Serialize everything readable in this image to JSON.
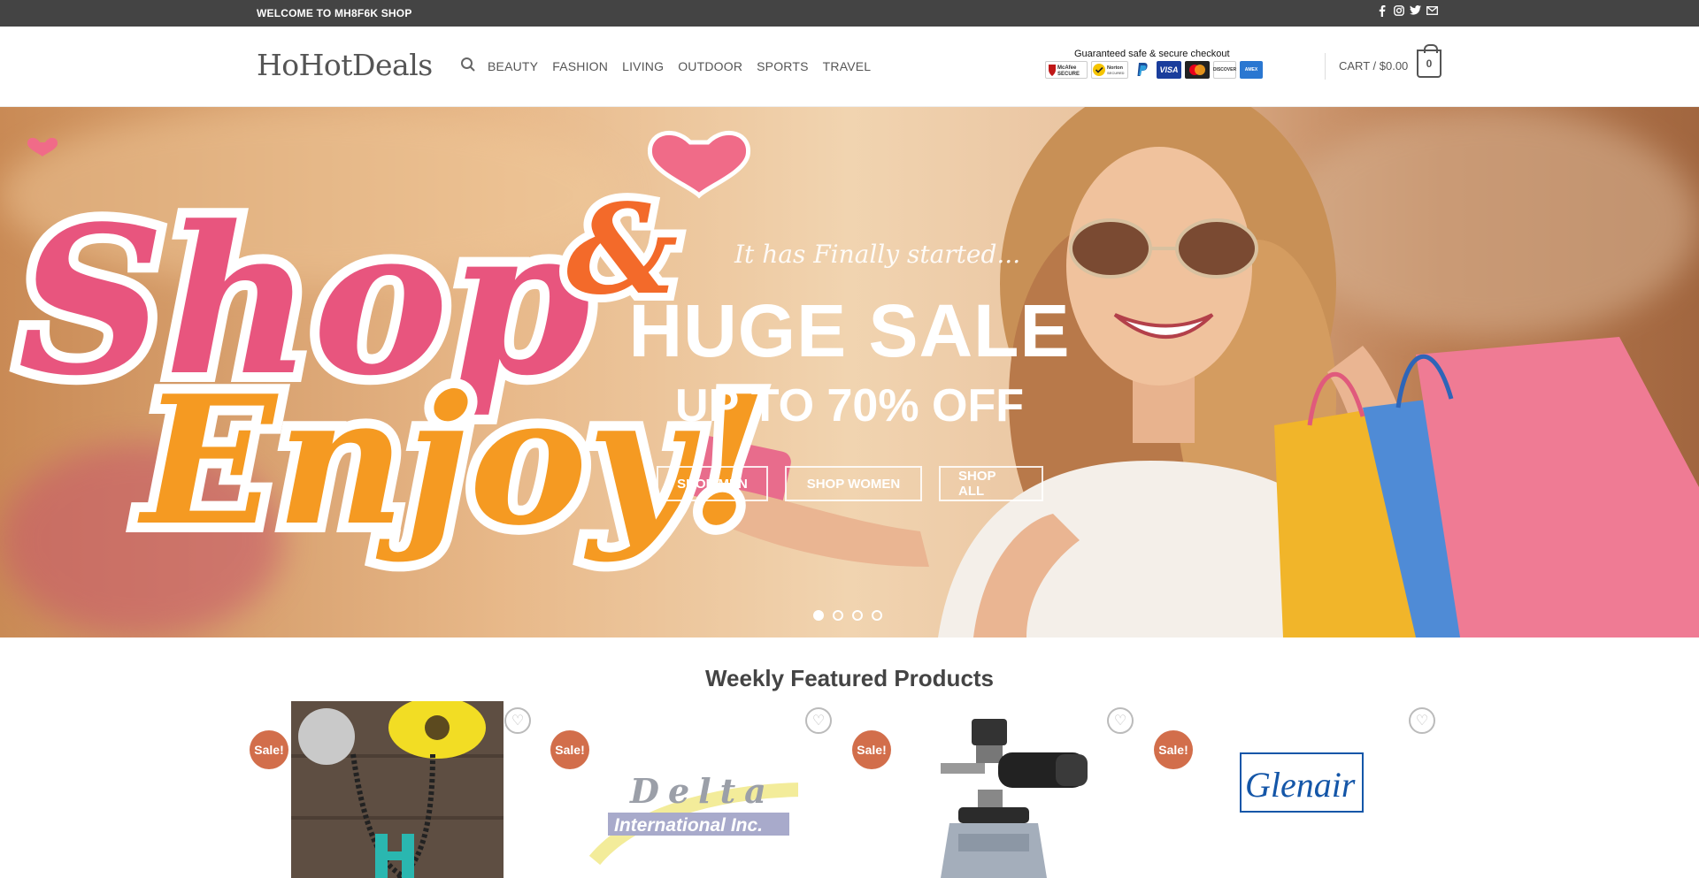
{
  "topbar": {
    "welcome": "WELCOME TO MH8F6K SHOP",
    "social_icons": [
      "facebook-icon",
      "instagram-icon",
      "twitter-icon",
      "email-icon"
    ]
  },
  "header": {
    "logo": "HoHotDeals",
    "nav": [
      "BEAUTY",
      "FASHION",
      "LIVING",
      "OUTDOOR",
      "SPORTS",
      "TRAVEL"
    ],
    "secure_caption": "Guaranteed safe & secure checkout",
    "cart_label": "CART / $0.00",
    "cart_count": "0"
  },
  "hero": {
    "art_line1": "Shop",
    "art_line2": "&",
    "art_line3": "Enjoy!",
    "pre": "It has Finally started...",
    "headline": "HUGE SALE",
    "sub": "UP TO 70% OFF",
    "buttons": [
      "SHOP MEN",
      "SHOP WOMEN",
      "SHOP ALL"
    ],
    "slides": 4,
    "active_slide": 1
  },
  "featured": {
    "title": "Weekly Featured Products",
    "sale_label": "Sale!",
    "products": [
      {
        "image": "turquoise-necklace"
      },
      {
        "image": "delta-logo",
        "logo_top": "Delta",
        "logo_bottom": "International Inc."
      },
      {
        "image": "foam-cannon"
      },
      {
        "image": "glenair-logo",
        "logo": "Glenair"
      }
    ]
  },
  "colors": {
    "topbar_bg": "#444444",
    "sale_badge": "#d26e4b",
    "text": "#555555"
  }
}
